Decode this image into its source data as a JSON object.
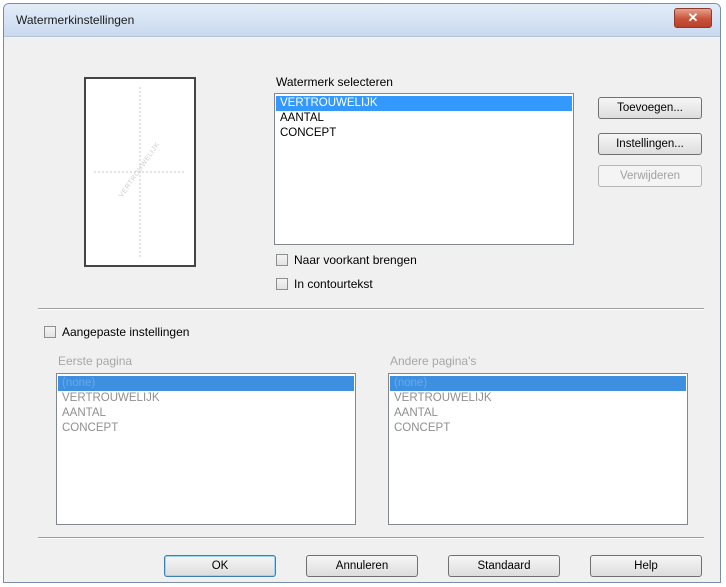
{
  "window": {
    "title": "Watermerkinstellingen",
    "close_glyph": "✕"
  },
  "preview": {
    "watermark_text": "VERTROUWELIJK"
  },
  "select_watermark": {
    "label": "Watermerk selecteren",
    "items": [
      "VERTROUWELIJK",
      "AANTAL",
      "CONCEPT"
    ],
    "selected_index": 0
  },
  "side_buttons": {
    "add": "Toevoegen...",
    "settings": "Instellingen...",
    "delete": "Verwijderen"
  },
  "options": {
    "bring_front": "Naar voorkant brengen",
    "outline": "In contourtekst"
  },
  "custom": {
    "checkbox_label": "Aangepaste instellingen",
    "first_page": {
      "label": "Eerste pagina",
      "items": [
        "(none)",
        "VERTROUWELIJK",
        "AANTAL",
        "CONCEPT"
      ],
      "selected_index": 0
    },
    "other_pages": {
      "label": "Andere pagina's",
      "items": [
        "(none)",
        "VERTROUWELIJK",
        "AANTAL",
        "CONCEPT"
      ],
      "selected_index": 0
    }
  },
  "footer": {
    "ok": "OK",
    "cancel": "Annuleren",
    "default": "Standaard",
    "help": "Help"
  }
}
